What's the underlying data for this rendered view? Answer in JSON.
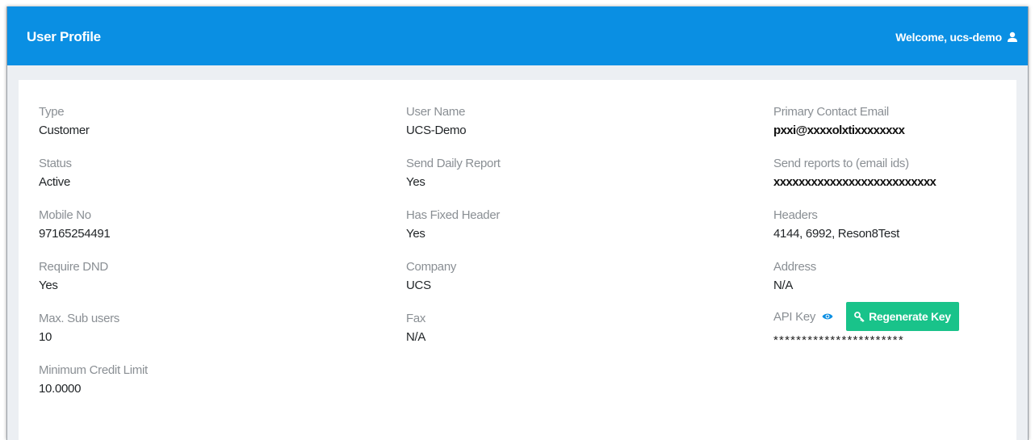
{
  "header": {
    "title": "User Profile",
    "welcome": "Welcome, ucs-demo",
    "accent_color": "#0a8fe3"
  },
  "profile": {
    "col1": [
      {
        "label": "Type",
        "value": "Customer"
      },
      {
        "label": "Status",
        "value": "Active"
      },
      {
        "label": "Mobile No",
        "value": "97165254491"
      },
      {
        "label": "Require DND",
        "value": "Yes"
      },
      {
        "label": "Max. Sub users",
        "value": "10"
      },
      {
        "label": "Minimum Credit Limit",
        "value": "10.0000"
      }
    ],
    "col2": [
      {
        "label": "User Name",
        "value": "UCS-Demo"
      },
      {
        "label": "Send Daily Report",
        "value": "Yes"
      },
      {
        "label": "Has Fixed Header",
        "value": "Yes"
      },
      {
        "label": "Company",
        "value": "UCS"
      },
      {
        "label": "Fax",
        "value": "N/A"
      }
    ],
    "col3": [
      {
        "label": "Primary Contact Email",
        "value": "pxxi@xxxxolxtixxxxxxxx"
      },
      {
        "label": "Send reports to (email ids)",
        "value": "xxxxxxxxxxxxxxxxxxxxxxxxxx"
      },
      {
        "label": "Headers",
        "value": "4144, 6992, Reson8Test"
      },
      {
        "label": "Address",
        "value": "N/A"
      }
    ],
    "api_key": {
      "label": "API Key",
      "button_label": "Regenerate Key",
      "button_color": "#19c38a",
      "masked_value": "***********************"
    }
  }
}
